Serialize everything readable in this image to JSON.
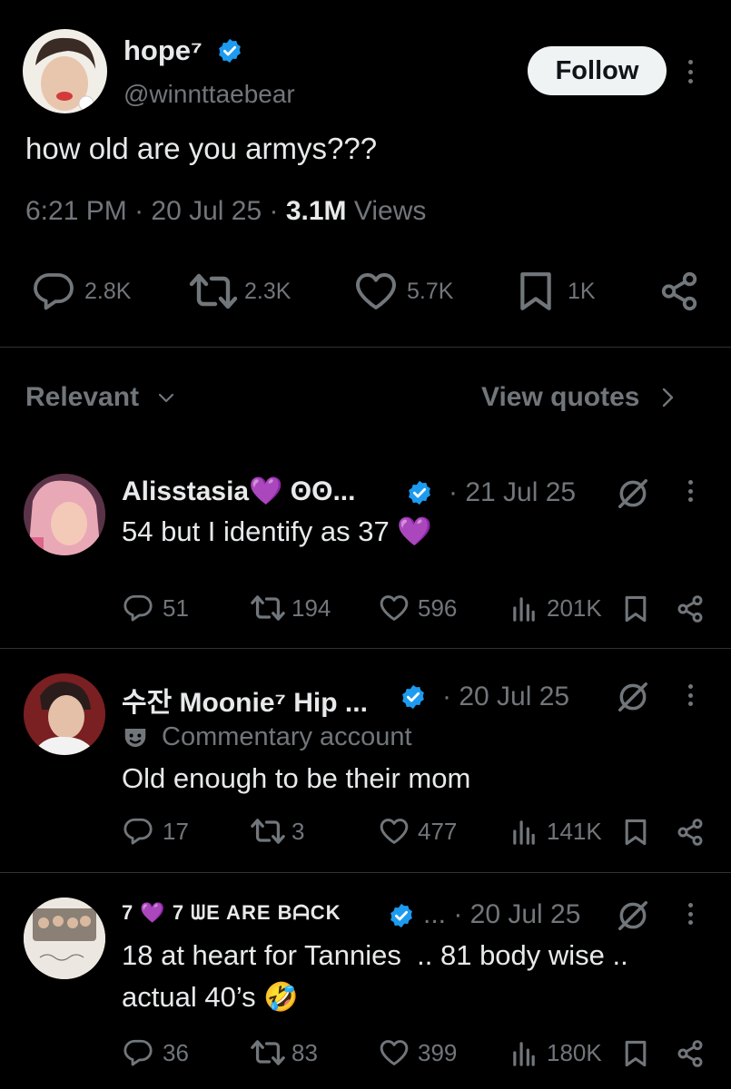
{
  "colors": {
    "background": "#000000",
    "text": "#e7e9ea",
    "muted": "#71767b",
    "verified": "#1d9bf0",
    "divider": "#2f3336",
    "heart_emoji": "#9b3ee8"
  },
  "post": {
    "author_name": "hope⁷",
    "author_handle": "@winnttaebear",
    "follow_label": "Follow",
    "text": "how old are you armys???",
    "time": "6:21 PM",
    "date": "20 Jul 25",
    "views_count": "3.1M",
    "views_label": "Views",
    "stats": {
      "replies": "2.8K",
      "reposts": "2.3K",
      "likes": "5.7K",
      "bookmarks": "1K"
    },
    "icons": [
      "reply-icon",
      "repost-icon",
      "heart-icon",
      "bookmark-icon",
      "share-icon"
    ]
  },
  "filter": {
    "sort_label": "Relevant",
    "quotes_label": "View quotes"
  },
  "replies": [
    {
      "name": "Alisstasia💜 ʘʘ...",
      "date": "· 21 Jul 25",
      "text": "54 but I identify as 37 💜",
      "stats": {
        "replies": "51",
        "reposts": "194",
        "likes": "596",
        "views": "201K"
      }
    },
    {
      "name": "수잔 Moonie⁷ Hip ...",
      "date": "· 20 Jul 25",
      "label": "Commentary account",
      "text": "Old enough to be their mom",
      "stats": {
        "replies": "17",
        "reposts": "3",
        "likes": "477",
        "views": "141K"
      }
    },
    {
      "name": "7 💜 7 ᗯE ARE BᗩCK",
      "date": "... · 20 Jul 25",
      "text_line1": "18 at heart for Tannies  .. 81 body wise ..",
      "text_line2": "actual 40’s 🤣",
      "stats": {
        "replies": "36",
        "reposts": "83",
        "likes": "399",
        "views": "180K"
      }
    }
  ]
}
